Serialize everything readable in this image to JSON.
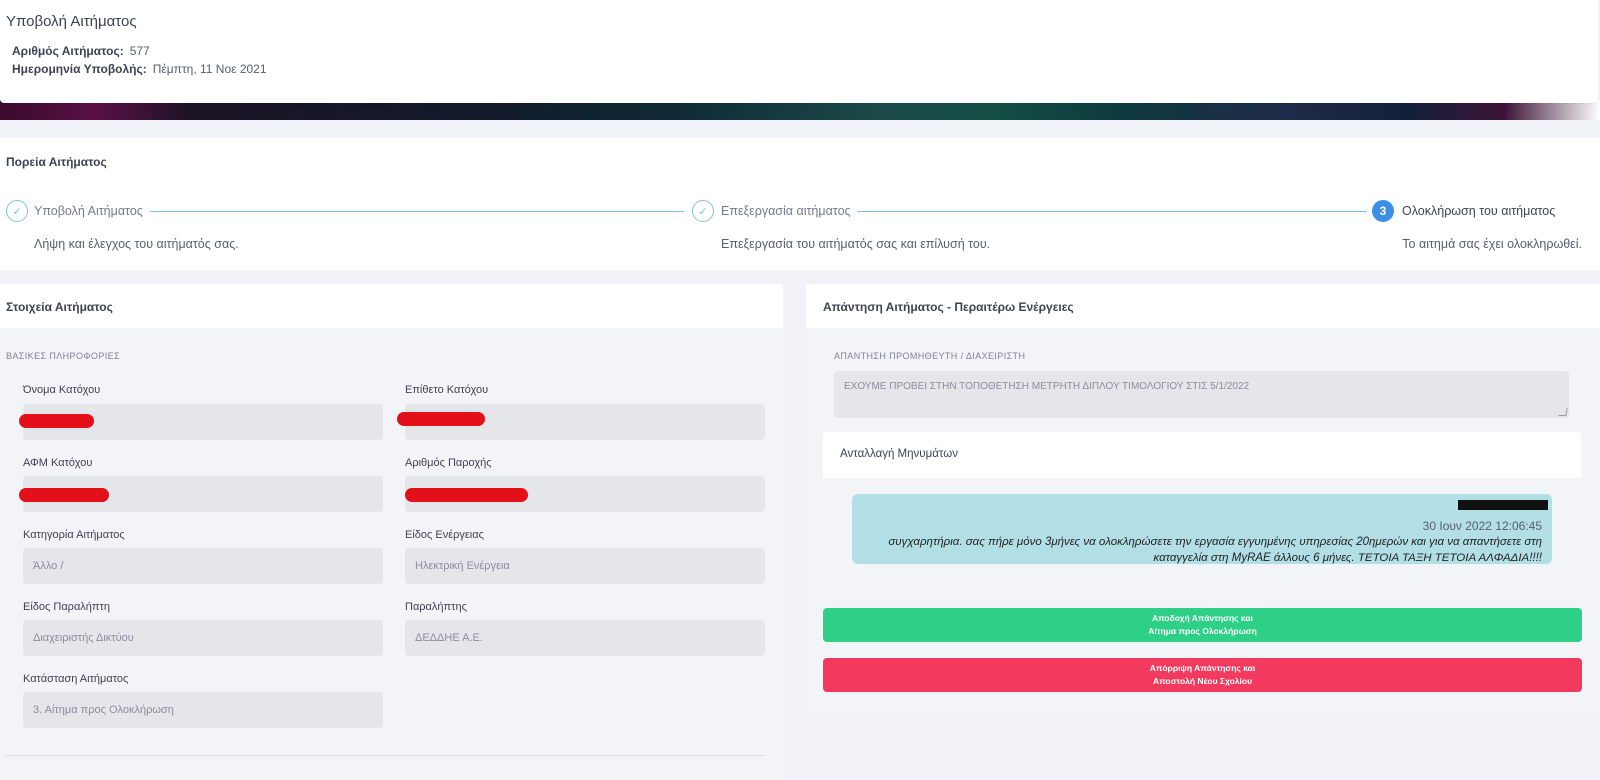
{
  "header": {
    "title": "Υποβολή Αιτήματος",
    "request_number_label": "Αριθμός Αιτήματος:",
    "request_number": "577",
    "submission_date_label": "Ημερομηνία Υποβολής:",
    "submission_date": "Πέμπτη, 11 Νοε 2021"
  },
  "progress": {
    "title": "Πορεία Αιτήματος",
    "steps": [
      {
        "label": "Υποβολή Αιτήματος",
        "description": "Λήψη και έλεγχος του αιτήματός σας.",
        "icon": "check-icon"
      },
      {
        "label": "Επεξεργασία αιτήματος",
        "description": "Επεξεργασία του αιτήματός σας και επίλυσή του.",
        "icon": "check-icon"
      },
      {
        "label": "Ολοκλήρωση του αιτήματος",
        "description": "Το αιτημά σας έχει ολοκληρωθεί.",
        "number": "3"
      }
    ]
  },
  "details": {
    "title": "Στοιχεία Αιτήματος",
    "section_label": "ΒΑΣΙΚΕΣ ΠΛΗΡΟΦΟΡΙΕΣ",
    "fields": {
      "owner_name": {
        "label": "Όνομα Κατόχου",
        "value": ""
      },
      "owner_surname": {
        "label": "Επίθετο Κατόχου",
        "value": ""
      },
      "owner_afm": {
        "label": "ΑΦΜ Κατόχου",
        "value": ""
      },
      "supply_number": {
        "label": "Αριθμός Παροχής",
        "value": ""
      },
      "category": {
        "label": "Κατηγορία Αιτήματος",
        "value": "Άλλο /"
      },
      "energy_type": {
        "label": "Είδος Ενέργειας",
        "value": "Ηλεκτρική Ενέργεια"
      },
      "recipient_type": {
        "label": "Είδος Παραλήπτη",
        "value": "Διαχειριστής Δικτύου"
      },
      "recipient": {
        "label": "Παραλήπτης",
        "value": "ΔΕΔΔΗΕ Α.Ε."
      },
      "status": {
        "label": "Κατάσταση Αιτήματος",
        "value": "3. Αίτημα προς Ολοκλήρωση"
      }
    },
    "redaction_color": "#e3101a"
  },
  "response": {
    "title": "Απάντηση Αιτήματος - Περαιτέρω Ενέργειες",
    "answer_label": "ΑΠΑΝΤΗΣΗ ΠΡΟΜΗΘΕΥΤΗ / ΔΙΑΧΕΙΡΙΣΤΗ",
    "answer_text": "ΕΧΟΥΜΕ ΠΡΟΒΕΙ ΣΤΗΝ ΤΟΠΟΘΕΤΗΣΗ ΜΕΤΡΗΤΗ ΔΙΠΛΟΥ ΤΙΜΟΛΟΓΙΟΥ ΣΤΙΣ 5/1/2022",
    "messages_title": "Ανταλλαγή Μηνυμάτων",
    "message": {
      "date": "30 Ιουν 2022 12:06:45",
      "text": "συγχαρητήρια. σας πήρε μόνο 3μήνες να ολοκληρώσετε την εργασία εγγυημένης υπηρεσίας 20ημερών και για να απαντήσετε στη καταγγελία στη MyRAE άλλους 6 μήνες. ΤΕΤΟΙΑ ΤΑΞΗ ΤΕΤΟΙΑ ΑΛΦΑΔΙΑ!!!!"
    },
    "accept_button": {
      "line1": "Αποδοχή Απάντησης και",
      "line2": "Αίτημα προς Ολοκλήρωση",
      "color": "#2ecf87"
    },
    "reject_button": {
      "line1": "Απόρριψη Απάντησης και",
      "line2": "Αποστολή Νέου Σχολίου",
      "color": "#f23a5e"
    }
  }
}
